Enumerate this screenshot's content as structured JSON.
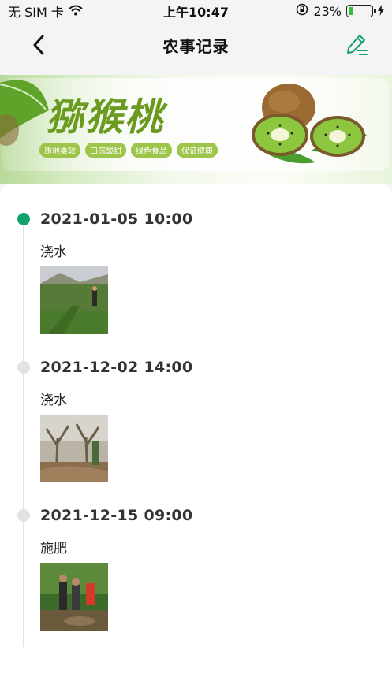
{
  "status_bar": {
    "carrier": "无 SIM 卡",
    "time": "上午10:47",
    "battery_percent": "23%",
    "battery_level": 0.23
  },
  "nav": {
    "title": "农事记录",
    "back_icon": "chevron-left-icon",
    "action_icon": "edit-pen-icon",
    "accent_color": "#12a36b"
  },
  "banner": {
    "title": "猕猴桃",
    "tags": [
      "质地柔软",
      "口感酸甜",
      "绿色食品",
      "保证健康"
    ]
  },
  "records": [
    {
      "time": "2021-01-05 10:00",
      "task": "浇水",
      "active": true
    },
    {
      "time": "2021-12-02 14:00",
      "task": "浇水",
      "active": false
    },
    {
      "time": "2021-12-15 09:00",
      "task": "施肥",
      "active": false
    }
  ]
}
